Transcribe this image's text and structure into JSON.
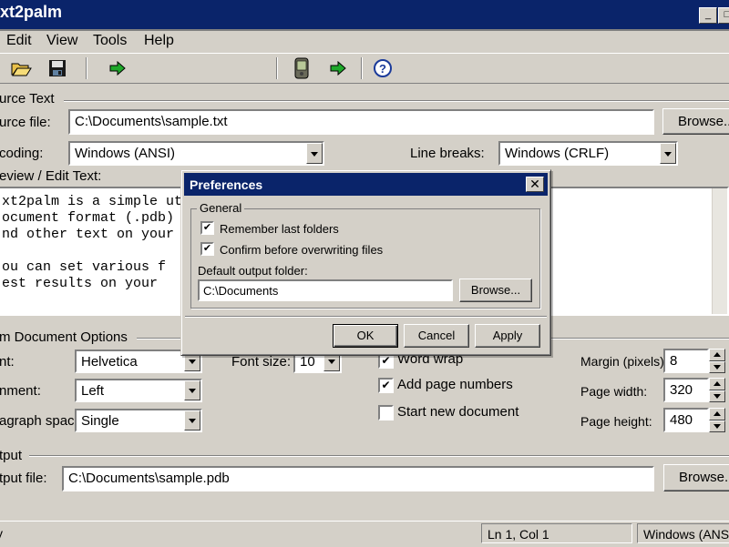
{
  "window": {
    "title": "xt2palm"
  },
  "menu": [
    "Edit",
    "View",
    "Tools",
    "Help"
  ],
  "toolbar": {
    "icons": [
      "open-folder",
      "save",
      "convert-arrow",
      "palm-device",
      "send-arrow",
      "help"
    ]
  },
  "source": {
    "group_title": "urce Text",
    "file_label": "urce file:",
    "file_value": "C:\\Documents\\sample.txt",
    "browse": "Browse...",
    "encoding_label": "coding:",
    "encoding_value": "Windows (ANSI)",
    "linebreaks_label": "Line breaks:",
    "linebreaks_value": "Windows (CRLF)",
    "preview_label": "eview / Edit Text:",
    "preview_text": "xt2palm is a simple ut\nocument format (.pdb)\nnd other text on your\n\nou can set various f\nest results on your"
  },
  "options": {
    "group_title": "m Document Options",
    "font_label": "nt:",
    "font_value": "Helvetica",
    "fontsize_label": "Font size:",
    "fontsize_value": "10",
    "alignment_label": "nment:",
    "alignment_value": "Left",
    "spacing_label": "agraph spacing:",
    "spacing_value": "Single",
    "word_wrap": "Word wrap",
    "page_numbers": "Add page numbers",
    "new_document": "Start new document",
    "margin_label": "Margin (pixels):",
    "margin_value": "8",
    "width_label": "Page width:",
    "width_value": "320",
    "height_label": "Page height:",
    "height_value": "480"
  },
  "output": {
    "group_title": "tput",
    "file_label": "tput file:",
    "file_value": "C:\\Documents\\sample.pdb",
    "browse": "Browse..."
  },
  "status": {
    "left": "y",
    "position": "Ln 1, Col 1",
    "encoding": "Windows (ANSI)"
  },
  "dialog": {
    "title": "Preferences",
    "group": "General",
    "remember": "Remember last folders",
    "confirm": "Confirm before overwriting files",
    "folder_label": "Default output folder:",
    "folder_value": "C:\\Documents",
    "browse": "Browse...",
    "ok": "OK",
    "cancel": "Cancel",
    "apply": "Apply"
  }
}
